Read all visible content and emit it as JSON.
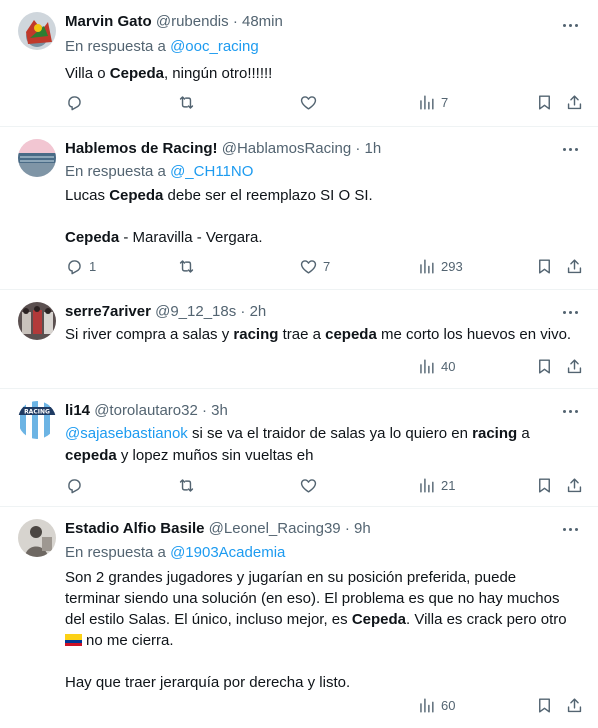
{
  "tweets": [
    {
      "name": "Marvin Gato",
      "handle": "@rubendis",
      "dot": "·",
      "time": "48min",
      "reply_prefix": "En respuesta a",
      "reply_to": "@ooc_racing",
      "lines": [
        {
          "parts": [
            {
              "t": "Villa o "
            },
            {
              "t": "Cepeda",
              "b": true
            },
            {
              "t": ", ningún otro!!!!!!"
            }
          ]
        }
      ],
      "stats": {
        "replies": "",
        "retweets": "",
        "likes": "",
        "views": "7"
      }
    },
    {
      "name": "Hablemos de Racing!",
      "handle": "@HablamosRacing",
      "dot": "·",
      "time": "1h",
      "reply_prefix": "En respuesta a",
      "reply_to": "@_CH11NO",
      "lines": [
        {
          "parts": [
            {
              "t": "Lucas "
            },
            {
              "t": "Cepeda",
              "b": true
            },
            {
              "t": " debe ser el reemplazo SI O SI."
            }
          ]
        },
        {
          "parts": [
            {
              "t": "Cepeda",
              "b": true
            },
            {
              "t": " - Maravilla - Vergara."
            }
          ]
        }
      ],
      "stats": {
        "replies": "1",
        "retweets": "",
        "likes": "7",
        "views": "293"
      }
    },
    {
      "name": "serre7ariver",
      "handle": "@9_12_18s",
      "dot": "·",
      "time": "2h",
      "lines": [
        {
          "parts": [
            {
              "t": "Si river compra a salas y "
            },
            {
              "t": "racing",
              "b": true
            },
            {
              "t": " trae a "
            },
            {
              "t": "cepeda",
              "b": true
            },
            {
              "t": " me corto los huevos en vivo."
            }
          ]
        }
      ],
      "stats": {
        "replies": "",
        "retweets": "",
        "likes": "",
        "views": "40"
      }
    },
    {
      "name": "li14",
      "handle": "@torolautaro32",
      "dot": "·",
      "time": "3h",
      "lines": [
        {
          "parts": [
            {
              "t": "@sajasebastianok",
              "m": true
            },
            {
              "t": " si se va el traidor de salas ya lo quiero en "
            },
            {
              "t": "racing",
              "b": true
            },
            {
              "t": " a"
            }
          ]
        },
        {
          "parts": [
            {
              "t": "cepeda",
              "b": true
            },
            {
              "t": " y lopez muños sin vueltas eh"
            }
          ]
        }
      ],
      "stats": {
        "replies": "",
        "retweets": "",
        "likes": "",
        "views": "21"
      }
    },
    {
      "name": "Estadio Alfio Basile",
      "handle": "@Leonel_Racing39",
      "dot": "·",
      "time": "9h",
      "reply_prefix": "En respuesta a",
      "reply_to": "@1903Academia",
      "lines": [
        {
          "parts": [
            {
              "t": "Son 2 grandes jugadores y jugarían en su posición preferida, puede"
            }
          ]
        },
        {
          "parts": [
            {
              "t": "terminar siendo una solución (en eso). El problema es que no hay muchos"
            }
          ]
        },
        {
          "parts": [
            {
              "t": "del estilo Salas. El único, incluso mejor, es "
            },
            {
              "t": "Cepeda",
              "b": true
            },
            {
              "t": ". Villa es crack pero otro"
            }
          ]
        },
        {
          "parts": [
            {
              "flag": "colombia"
            },
            {
              "t": "no me cierra."
            }
          ]
        },
        {
          "parts": [
            {
              "t": "Hay que traer jerarquía por derecha y listo."
            }
          ]
        }
      ],
      "stats": {
        "replies": "",
        "retweets": "",
        "likes": "",
        "views": "60"
      }
    }
  ]
}
